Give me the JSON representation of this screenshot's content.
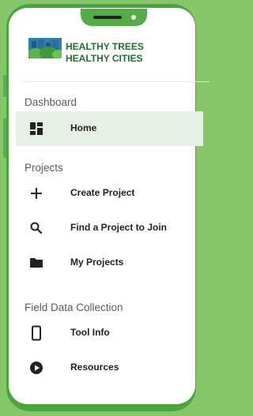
{
  "brand": {
    "line1": "HEALTHY TREES",
    "line2": "HEALTHY CITIES"
  },
  "sections": {
    "dashboard": "Dashboard",
    "projects": "Projects",
    "field": "Field Data Collection"
  },
  "nav": {
    "home": "Home",
    "create_project": "Create Project",
    "find_project": "Find a Project to Join",
    "my_projects": "My Projects",
    "tool_info": "Tool Info",
    "resources": "Resources"
  },
  "icons": {
    "home": "dashboard-icon",
    "create_project": "plus-icon",
    "find_project": "search-icon",
    "my_projects": "folder-icon",
    "tool_info": "phone-icon",
    "resources": "play-circle-icon"
  },
  "colors": {
    "accent": "#49a63f",
    "background": "#86c56a",
    "active_row": "#e6f0e3",
    "brand_text": "#1f6f2f"
  }
}
